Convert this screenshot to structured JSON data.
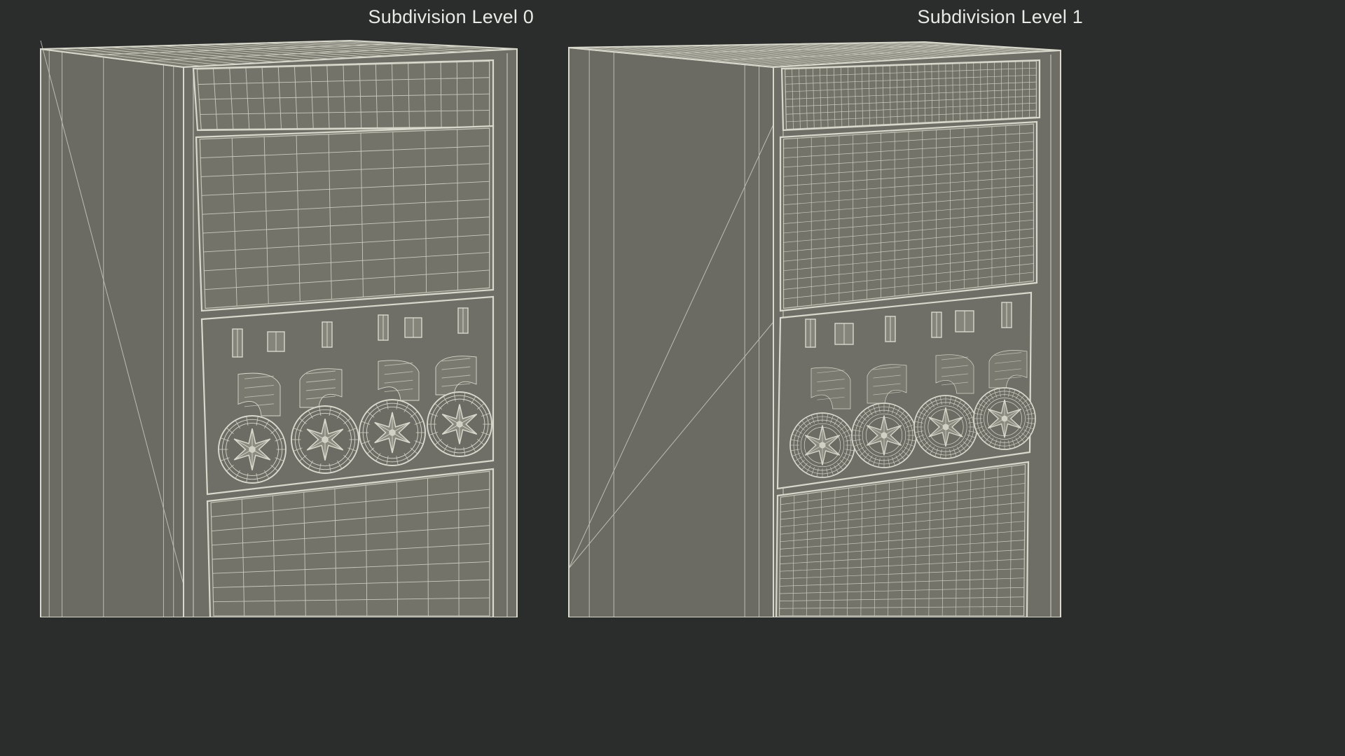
{
  "viewports": [
    {
      "label": "Subdivision Level 0"
    },
    {
      "label": "Subdivision Level 1"
    }
  ],
  "colors": {
    "background": "#2b2c2c",
    "side_face": "#6b6b63",
    "front_face": "#6e6e66",
    "panel": "#73736a",
    "wire": "#d8d8cc",
    "label": "#e9e9e6"
  }
}
